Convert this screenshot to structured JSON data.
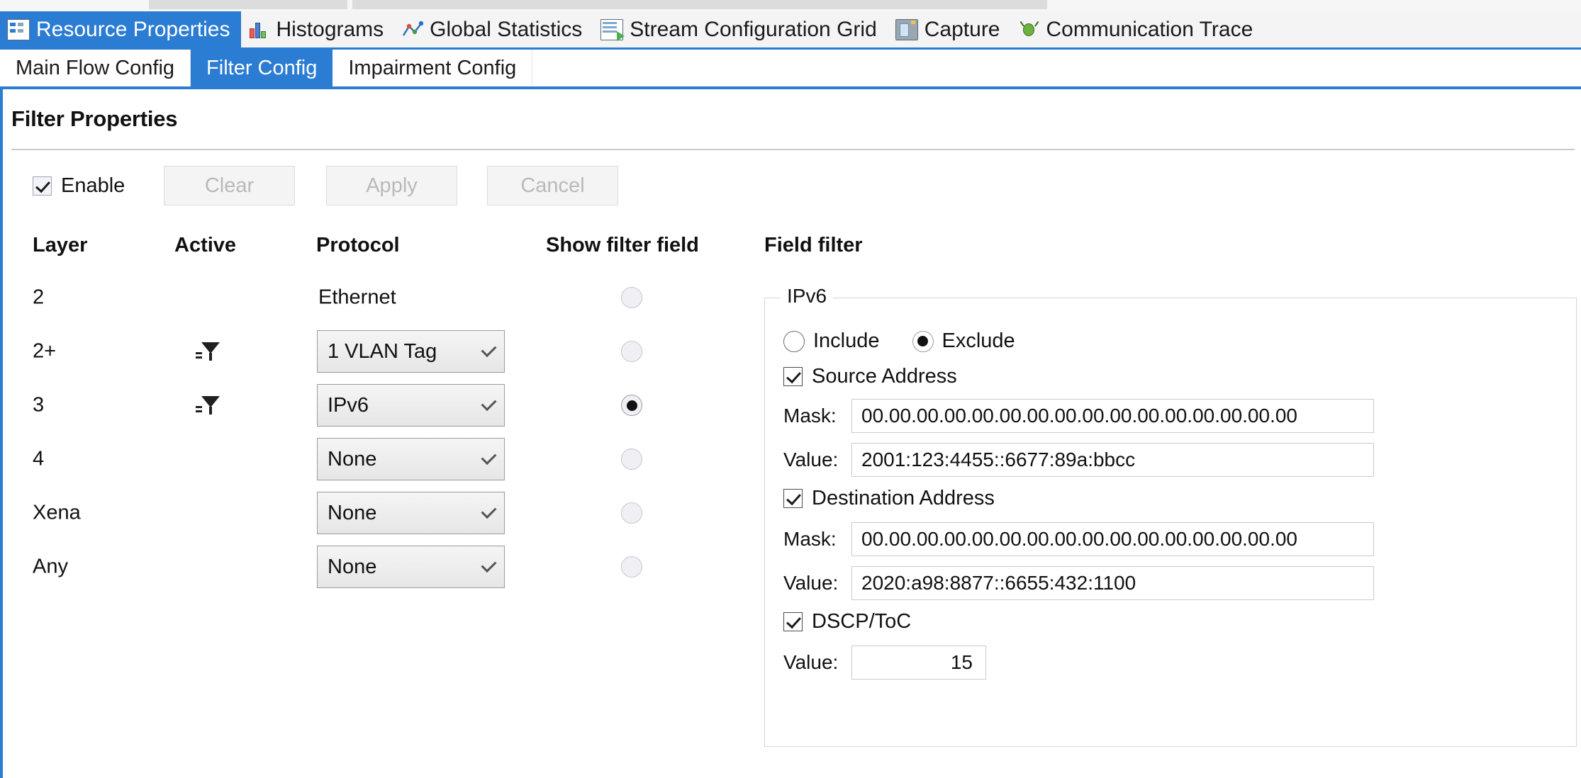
{
  "main_tabs": [
    {
      "label": "Resource Properties",
      "icon": "resource-properties-icon",
      "selected": true
    },
    {
      "label": "Histograms",
      "icon": "histograms-icon",
      "selected": false
    },
    {
      "label": "Global Statistics",
      "icon": "global-statistics-icon",
      "selected": false
    },
    {
      "label": "Stream Configuration Grid",
      "icon": "stream-configuration-grid-icon",
      "selected": false
    },
    {
      "label": "Capture",
      "icon": "capture-icon",
      "selected": false
    },
    {
      "label": "Communication Trace",
      "icon": "communication-trace-icon",
      "selected": false
    }
  ],
  "sub_tabs": [
    {
      "label": "Main Flow Config",
      "selected": false
    },
    {
      "label": "Filter Config",
      "selected": true
    },
    {
      "label": "Impairment Config",
      "selected": false
    }
  ],
  "page": {
    "title": "Filter Properties"
  },
  "toolbar": {
    "enable_label": "Enable",
    "enable_checked": true,
    "clear_label": "Clear",
    "apply_label": "Apply",
    "cancel_label": "Cancel",
    "buttons_disabled": true
  },
  "table": {
    "headers": {
      "layer": "Layer",
      "active": "Active",
      "protocol": "Protocol",
      "show_filter_field": "Show filter field",
      "field_filter": "Field filter"
    },
    "rows": [
      {
        "layer": "2",
        "active_icon": false,
        "protocol": "Ethernet",
        "protocol_is_dropdown": false,
        "radio_selected": false
      },
      {
        "layer": "2+",
        "active_icon": true,
        "protocol": "1 VLAN Tag",
        "protocol_is_dropdown": true,
        "radio_selected": false
      },
      {
        "layer": "3",
        "active_icon": true,
        "protocol": "IPv6",
        "protocol_is_dropdown": true,
        "radio_selected": true
      },
      {
        "layer": "4",
        "active_icon": false,
        "protocol": "None",
        "protocol_is_dropdown": true,
        "radio_selected": false
      },
      {
        "layer": "Xena",
        "active_icon": false,
        "protocol": "None",
        "protocol_is_dropdown": true,
        "radio_selected": false
      },
      {
        "layer": "Any",
        "active_icon": false,
        "protocol": "None",
        "protocol_is_dropdown": true,
        "radio_selected": false
      }
    ]
  },
  "field_filter": {
    "legend": "IPv6",
    "mode": {
      "include_label": "Include",
      "exclude_label": "Exclude",
      "selected": "Exclude"
    },
    "source_address": {
      "label": "Source Address",
      "checked": true,
      "mask_label": "Mask:",
      "mask_value": "00.00.00.00.00.00.00.00.00.00.00.00.00.00.00.00",
      "value_label": "Value:",
      "value": "2001:123:4455::6677:89a:bbcc"
    },
    "destination_address": {
      "label": "Destination Address",
      "checked": true,
      "mask_label": "Mask:",
      "mask_value": "00.00.00.00.00.00.00.00.00.00.00.00.00.00.00.00",
      "value_label": "Value:",
      "value": "2020:a98:8877::6655:432:1100"
    },
    "dscp": {
      "label": "DSCP/ToC",
      "checked": true,
      "value_label": "Value:",
      "value": "15"
    }
  },
  "colors": {
    "accent": "#2b7cd3",
    "tab_selected_text": "#ffffff",
    "text": "#111111",
    "disabled_text": "#b9b9b9",
    "groupbox_border": "#d2d5e0"
  }
}
